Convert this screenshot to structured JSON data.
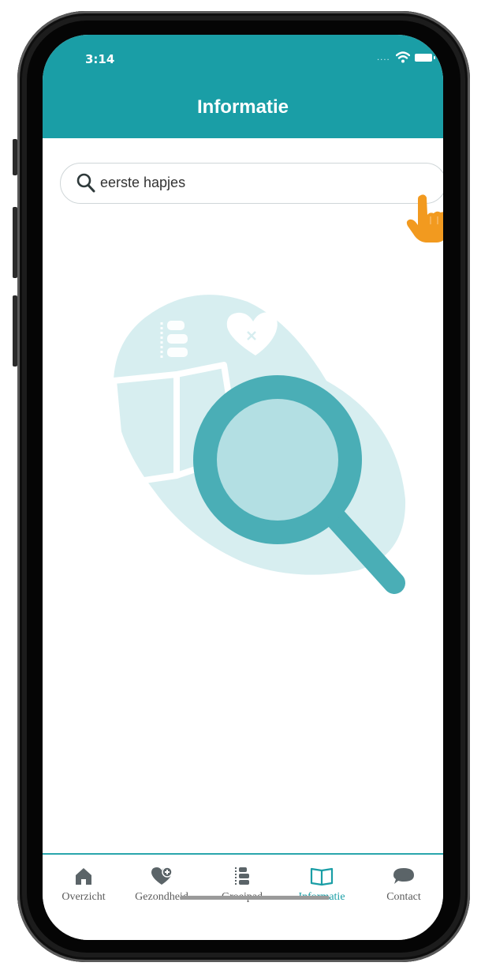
{
  "status_bar": {
    "time": "3:14"
  },
  "header": {
    "title": "Informatie"
  },
  "search": {
    "value": "eerste hapjes"
  },
  "tabs": [
    {
      "label": "Overzicht",
      "icon": "home-icon",
      "active": false
    },
    {
      "label": "Gezondheid",
      "icon": "heart-plus-icon",
      "active": false
    },
    {
      "label": "Groeipad",
      "icon": "growth-path-icon",
      "active": false
    },
    {
      "label": "Informatie",
      "icon": "open-book-icon",
      "active": true
    },
    {
      "label": "Contact",
      "icon": "chat-bubble-icon",
      "active": false
    }
  ],
  "colors": {
    "accent": "#1a9ea6",
    "illustration_light": "#d7eef0",
    "illustration_dark": "#4aaeb6",
    "pointer": "#f29a1f"
  }
}
